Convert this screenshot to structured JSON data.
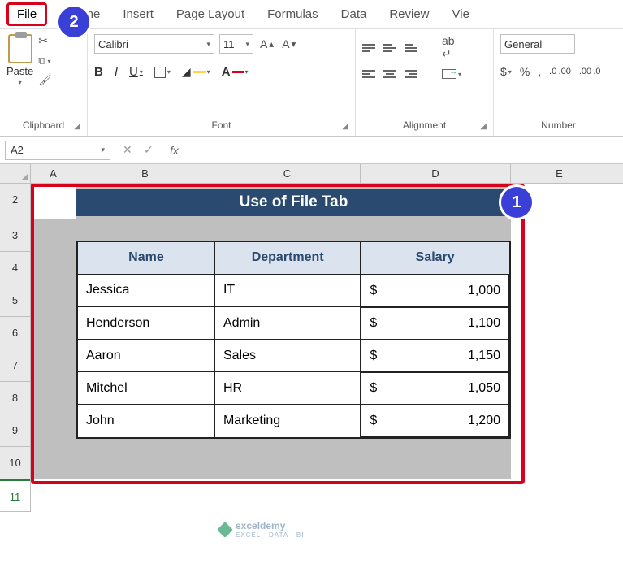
{
  "tabs": {
    "file": "File",
    "home": "ome",
    "insert": "Insert",
    "pagelayout": "Page Layout",
    "formulas": "Formulas",
    "data": "Data",
    "review": "Review",
    "view": "Vie"
  },
  "ribbon": {
    "clipboard": {
      "paste": "Paste",
      "label": "Clipboard"
    },
    "font": {
      "name": "Calibri",
      "size": "11",
      "bold": "B",
      "italic": "I",
      "underline": "U",
      "label": "Font"
    },
    "alignment": {
      "label": "Alignment"
    },
    "number": {
      "format": "General",
      "currency": "$",
      "percent": "%",
      "comma": ",",
      "dec_inc": ".0 .00",
      "dec_dec": ".00 .0",
      "label": "Number"
    }
  },
  "fx": {
    "cellref": "A2",
    "cancel": "✕",
    "confirm": "✓",
    "fx": "fx"
  },
  "cols": {
    "A": "A",
    "B": "B",
    "C": "C",
    "D": "D",
    "E": "E"
  },
  "rows": {
    "r2": "2",
    "r3": "3",
    "r4": "4",
    "r5": "5",
    "r6": "6",
    "r7": "7",
    "r8": "8",
    "r9": "9",
    "r10": "10",
    "r11": "11"
  },
  "sheet": {
    "title": "Use of  File Tab",
    "headers": {
      "name": "Name",
      "dept": "Department",
      "sal": "Salary"
    },
    "rows": [
      {
        "name": "Jessica",
        "dept": "IT",
        "cur": "$",
        "sal": "1,000"
      },
      {
        "name": "Henderson",
        "dept": "Admin",
        "cur": "$",
        "sal": "1,100"
      },
      {
        "name": "Aaron",
        "dept": "Sales",
        "cur": "$",
        "sal": "1,150"
      },
      {
        "name": "Mitchel",
        "dept": "HR",
        "cur": "$",
        "sal": "1,050"
      },
      {
        "name": "John",
        "dept": "Marketing",
        "cur": "$",
        "sal": "1,200"
      }
    ]
  },
  "callouts": {
    "one": "1",
    "two": "2"
  },
  "watermark": {
    "brand": "exceldemy",
    "sub": "EXCEL · DATA · BI"
  }
}
